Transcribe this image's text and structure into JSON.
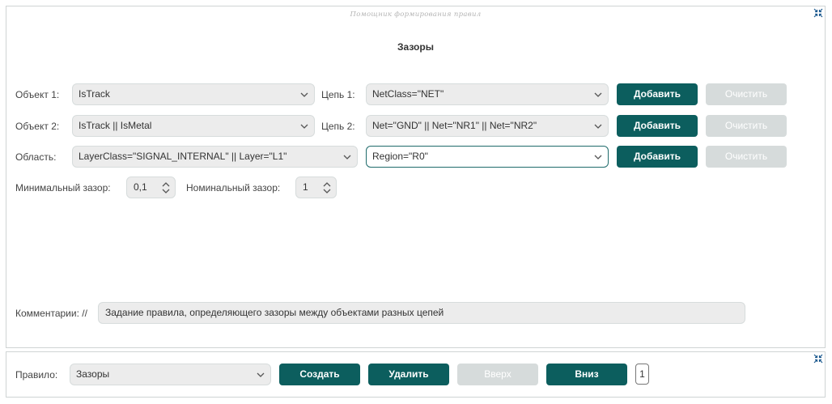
{
  "panel": {
    "caption": "Помощник формирования правил",
    "section_title": "Зазоры"
  },
  "rows": [
    {
      "left_label": "Объект 1:",
      "left_value": "IsTrack",
      "right_label": "Цепь 1:",
      "right_value": "NetClass=\"NET\"",
      "add_label": "Добавить",
      "clear_label": "Очистить"
    },
    {
      "left_label": "Объект 2:",
      "left_value": "IsTrack || IsMetal",
      "right_label": "Цепь 2:",
      "right_value": "Net=\"GND\" || Net=\"NR1\" || Net=\"NR2\"",
      "add_label": "Добавить",
      "clear_label": "Очистить"
    },
    {
      "left_label": "Область:",
      "left_value": "LayerClass=\"SIGNAL_INTERNAL\" || Layer=\"L1\"",
      "right_value": "Region=\"R0\"",
      "add_label": "Добавить",
      "clear_label": "Очистить"
    }
  ],
  "clearance": {
    "min_label": "Минимальный зазор:",
    "min_value": "0,1",
    "nominal_label": "Номинальный зазор:",
    "nominal_value": "1"
  },
  "comment": {
    "label": "Комментарии: //",
    "value": "Задание правила, определяющего зазоры между объектами разных цепей"
  },
  "rule_bar": {
    "label": "Правило:",
    "value": "Зазоры",
    "create_label": "Создать",
    "delete_label": "Удалить",
    "up_label": "Вверх",
    "down_label": "Вниз",
    "count": "1"
  },
  "colors": {
    "accent": "#0c5e5e",
    "disabled": "#d6dbdb",
    "field_bg": "#ececec",
    "border": "#cfd4d4"
  }
}
